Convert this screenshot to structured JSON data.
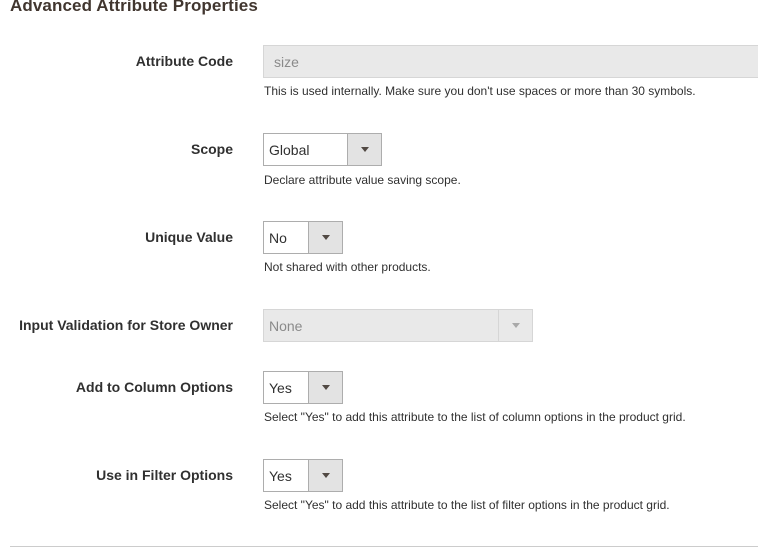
{
  "section": {
    "title": "Advanced Attribute Properties"
  },
  "fields": {
    "attribute_code": {
      "label": "Attribute Code",
      "value": "size",
      "note": "This is used internally. Make sure you don't use spaces or more than 30 symbols.",
      "disabled": true
    },
    "scope": {
      "label": "Scope",
      "value": "Global",
      "note": "Declare attribute value saving scope."
    },
    "unique_value": {
      "label": "Unique Value",
      "value": "No",
      "note": "Not shared with other products."
    },
    "input_validation": {
      "label": "Input Validation for Store Owner",
      "value": "None",
      "disabled": true
    },
    "column_options": {
      "label": "Add to Column Options",
      "value": "Yes",
      "note": "Select \"Yes\" to add this attribute to the list of column options in the product grid."
    },
    "filter_options": {
      "label": "Use in Filter Options",
      "value": "Yes",
      "note": "Select \"Yes\" to add this attribute to the list of filter options in the product grid."
    }
  },
  "icons": {
    "dropdown": "chevron-down-icon"
  },
  "colors": {
    "title_text": "#41362f",
    "label_text": "#303030",
    "select_border": "#adadad",
    "select_button": "#e3e3e3",
    "disabled_bg": "#e9e9e9",
    "disabled_text": "#8a8a8a"
  }
}
